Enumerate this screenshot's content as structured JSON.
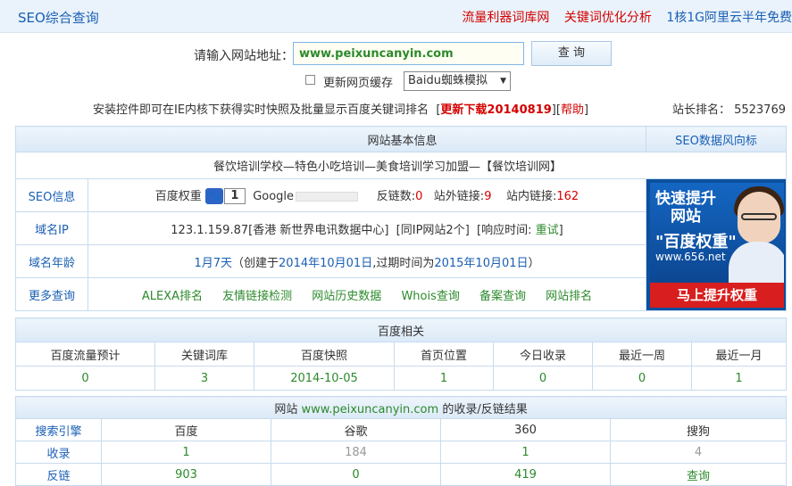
{
  "header": {
    "brand": "SEO综合查询",
    "links": [
      "流量利器词库网",
      "关键词优化分析",
      "1核1G阿里云半年免费"
    ]
  },
  "search": {
    "label": "请输入网站地址：",
    "value": "www.peixuncanyin.com",
    "button": "查 询"
  },
  "options": {
    "cache_label": "更新网页缓存",
    "spider_select": "Baidu蜘蛛模拟"
  },
  "notice": {
    "text": "安装控件即可在IE内核下获得实时快照及批量显示百度关键词排名",
    "download": "更新下载20140819",
    "help": "帮助",
    "rank_label": "站长排名：",
    "rank_value": "5523769"
  },
  "basic": {
    "title": "网站基本信息",
    "trend_link": "SEO数据风向标",
    "site_title": "餐饮培训学校—特色小吃培训—美食培训学习加盟—【餐饮培训网】",
    "seo": {
      "label": "SEO信息",
      "br_label": "百度权重",
      "br_icon_glyph": "🐾",
      "br_value": "1",
      "google_label": "Google",
      "backlinks_label": "反链数:",
      "backlinks_value": "0",
      "outlinks_label": "站外链接:",
      "outlinks_value": "9",
      "inlinks_label": "站内链接:",
      "inlinks_value": "162"
    },
    "ip": {
      "label": "域名IP",
      "value": "123.1.159.87[香港 新世界电讯数据中心]",
      "same_ip": "[同IP网站2个]",
      "resp_label": "[响应时间:",
      "resp_link": "重试",
      "resp_end": "]"
    },
    "age": {
      "label": "域名年龄",
      "value": "1月7天",
      "created_prefix": "（创建于",
      "created": "2014年10月01日",
      "expire_prefix": ",过期时间为",
      "expire": "2015年10月01日",
      "suffix": "）"
    },
    "more": {
      "label": "更多查询",
      "links": [
        "ALEXA排名",
        "友情链接检测",
        "网站历史数据",
        "Whois查询",
        "备案查询",
        "网站排名"
      ]
    },
    "ad": {
      "line1": "快速提升",
      "line2": "网站",
      "line3": "\"百度权重\"",
      "line4": "www.656.net",
      "button": "马上提升权重"
    }
  },
  "baidu": {
    "title": "百度相关",
    "headers": [
      "百度流量预计",
      "关键词库",
      "百度快照",
      "首页位置",
      "今日收录",
      "最近一周",
      "最近一月"
    ],
    "values": [
      "0",
      "3",
      "2014-10-05",
      "1",
      "0",
      "0",
      "1"
    ]
  },
  "index": {
    "title_prefix": "网站",
    "title_site": "www.peixuncanyin.com",
    "title_suffix": "的收录/反链结果",
    "headers": [
      "搜索引擎",
      "百度",
      "谷歌",
      "360",
      "搜狗"
    ],
    "rows": [
      {
        "label": "收录",
        "values": [
          "1",
          "184",
          "1",
          "4"
        ]
      },
      {
        "label": "反链",
        "values": [
          "903",
          "0",
          "419",
          "查询"
        ]
      }
    ]
  },
  "colors": {
    "accent_blue": "#1a5fb4",
    "alert_red": "#d40000",
    "link_green": "#2c8a2c"
  }
}
